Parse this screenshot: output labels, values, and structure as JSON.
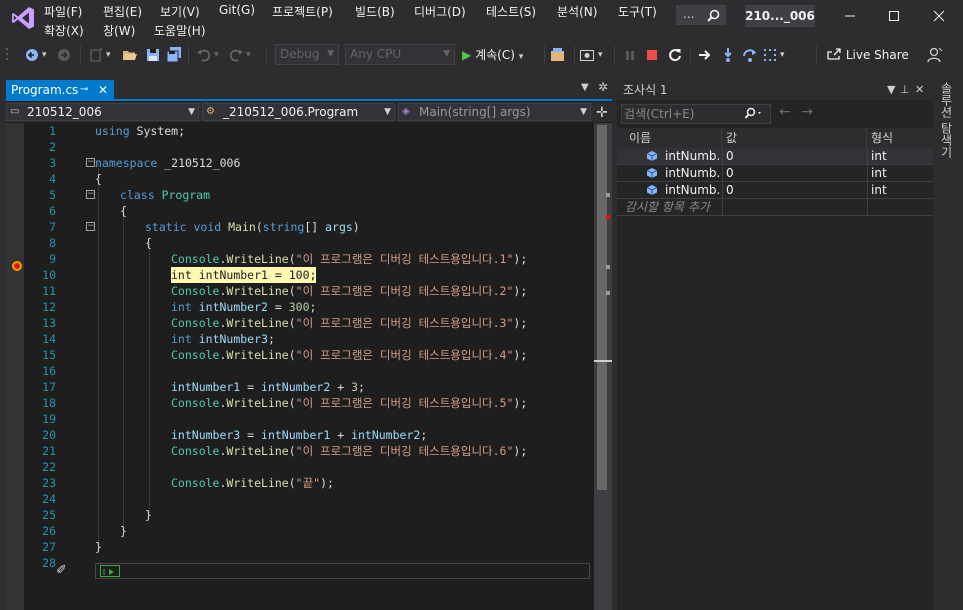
{
  "app": {
    "window_title": "210..._006",
    "search_dots": "..."
  },
  "menu": [
    {
      "label": "파일(F)"
    },
    {
      "label": "편집(E)"
    },
    {
      "label": "보기(V)"
    },
    {
      "label": "Git(G)"
    },
    {
      "label": "프로젝트(P)"
    },
    {
      "label": "빌드(B)"
    },
    {
      "label": "디버그(D)"
    },
    {
      "label": "테스트(S)"
    },
    {
      "label": "분석(N)"
    },
    {
      "label": "도구(T)"
    },
    {
      "label": "확장(X)"
    },
    {
      "label": "창(W)"
    },
    {
      "label": "도움말(H)"
    }
  ],
  "toolbar": {
    "config": "Debug",
    "platform": "Any CPU",
    "continue_label": "계속(C)",
    "live_share": "Live Share"
  },
  "editor": {
    "tab_label": "Program.cs",
    "nav_project": "210512_006",
    "nav_class": "_210512_006.Program",
    "nav_member": "Main(string[] args)",
    "breakpoint_line": 10,
    "current_line": 26,
    "lines": [
      {
        "n": "1",
        "text": "using System;"
      },
      {
        "n": "2",
        "text": ""
      },
      {
        "n": "3",
        "text": "namespace _210512_006"
      },
      {
        "n": "4",
        "text": "{"
      },
      {
        "n": "5",
        "text": "class Program"
      },
      {
        "n": "6",
        "text": "{"
      },
      {
        "n": "7",
        "text": "static void Main(string[] args)"
      },
      {
        "n": "8",
        "text": "{"
      },
      {
        "n": "9",
        "text": "Console.WriteLine(\"이 프로그램은 디버깅 테스트용입니다.1\");"
      },
      {
        "n": "10",
        "text": "int intNumber1 = 100;"
      },
      {
        "n": "11",
        "text": "Console.WriteLine(\"이 프로그램은 디버깅 테스트용입니다.2\");"
      },
      {
        "n": "12",
        "text": "int intNumber2 = 300;"
      },
      {
        "n": "13",
        "text": "Console.WriteLine(\"이 프로그램은 디버깅 테스트용입니다.3\");"
      },
      {
        "n": "14",
        "text": "int intNumber3;"
      },
      {
        "n": "15",
        "text": "Console.WriteLine(\"이 프로그램은 디버깅 테스트용입니다.4\");"
      },
      {
        "n": "16",
        "text": ""
      },
      {
        "n": "17",
        "text": "intNumber1 = intNumber2 + 3;"
      },
      {
        "n": "18",
        "text": "Console.WriteLine(\"이 프로그램은 디버깅 테스트용입니다.5\");"
      },
      {
        "n": "19",
        "text": ""
      },
      {
        "n": "20",
        "text": "intNumber3 = intNumber1 + intNumber2;"
      },
      {
        "n": "21",
        "text": "Console.WriteLine(\"이 프로그램은 디버깅 테스트용입니다.6\");"
      },
      {
        "n": "22",
        "text": ""
      },
      {
        "n": "23",
        "text": "Console.WriteLine(\"끝\");"
      },
      {
        "n": "24",
        "text": ""
      },
      {
        "n": "25",
        "text": "}"
      },
      {
        "n": "26",
        "text": "}"
      },
      {
        "n": "27",
        "text": "}"
      },
      {
        "n": "28",
        "text": ""
      }
    ]
  },
  "watch": {
    "title": "조사식 1",
    "search_placeholder": "검색(Ctrl+E)",
    "col_name": "이름",
    "col_value": "값",
    "col_type": "형식",
    "rows": [
      {
        "name": "intNumb...",
        "value": "0",
        "type": "int"
      },
      {
        "name": "intNumb...",
        "value": "0",
        "type": "int"
      },
      {
        "name": "intNumb...",
        "value": "0",
        "type": "int"
      }
    ],
    "add_item": "감시할 항목 추가"
  },
  "side_tab": "솔루션 탐색기",
  "colors": {
    "accent": "#007acc",
    "breakpoint": "#e51400",
    "breakpoint_highlight": "#fff8b3"
  }
}
